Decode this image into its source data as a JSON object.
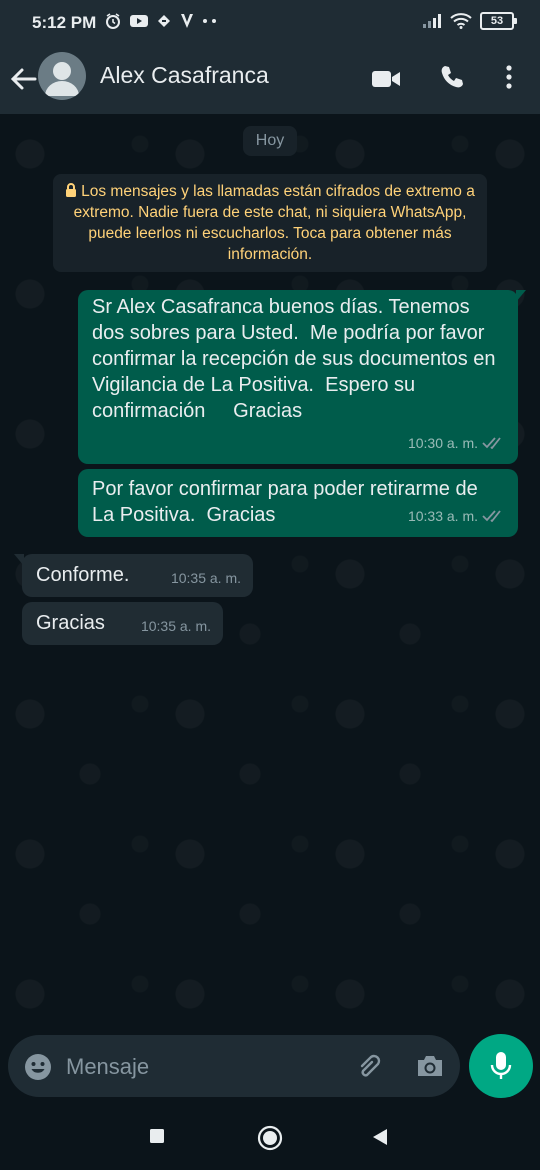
{
  "status_bar": {
    "time": "5:12 PM",
    "battery": "53",
    "icons": [
      "alarm-icon",
      "youtube-icon",
      "app-icon",
      "vpn-icon",
      "more-dots-icon",
      "signal-icon",
      "wifi-icon",
      "battery-icon"
    ]
  },
  "app_bar": {
    "contact_name": "Alex Casafranca",
    "icons": [
      "back-arrow-icon",
      "avatar",
      "video-call-icon",
      "voice-call-icon",
      "overflow-menu-icon"
    ]
  },
  "chat": {
    "date_chip": "Hoy",
    "encryption_notice": "Los mensajes y las llamadas están cifrados de extremo a extremo. Nadie fuera de este chat, ni siquiera WhatsApp, puede leerlos ni escucharlos. Toca para obtener más información.",
    "messages": [
      {
        "direction": "out",
        "text": "Sr Alex Casafranca buenos días. Tenemos dos sobres para Usted.  Me podría por favor confirmar la recepción de sus documentos en Vigilancia de La Positiva.  Espero su confirmación     Gracias",
        "time": "10:30 a. m.",
        "status": "read-ticks"
      },
      {
        "direction": "out",
        "text": "Por favor confirmar para poder retirarme de La Positiva.  Gracias",
        "time": "10:33 a. m.",
        "status": "read-ticks"
      },
      {
        "direction": "in",
        "text": "Conforme.",
        "time": "10:35 a. m."
      },
      {
        "direction": "in",
        "text": "Gracias",
        "time": "10:35 a. m."
      }
    ]
  },
  "input_bar": {
    "placeholder": "Mensaje",
    "icons": [
      "emoji-icon",
      "attach-icon",
      "camera-icon",
      "mic-icon"
    ]
  },
  "colors": {
    "header_bg": "#1f2c34",
    "chat_bg": "#0b141a",
    "outgoing_bubble": "#005c4b",
    "incoming_bubble": "#202c33",
    "accent": "#00a884",
    "notice_text": "#ffd279"
  }
}
